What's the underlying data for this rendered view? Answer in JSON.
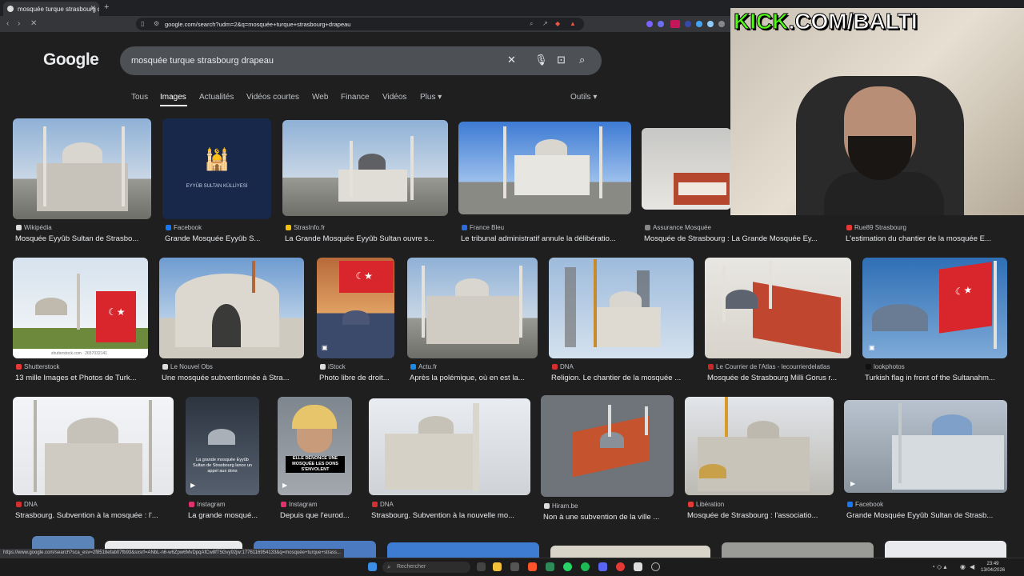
{
  "browser": {
    "tab_title": "mosquée turque strasbourg drap",
    "new_tab": "+",
    "url": "google.com/search?udm=2&q=mosquée+turque+strasbourg+drapeau",
    "status_url": "https://www.google.com/search?sca_esv=2f8518efab07fb93&sxsrf=ANbL-n6-w6Zpw6MvDpqAfCw8fT5Gvy92jw:1776116954133&q=mosquée+turque+strass..."
  },
  "google": {
    "logo": "Google",
    "query": "mosquée turque strasbourg drapeau",
    "filters": [
      "Tous",
      "Images",
      "Actualités",
      "Vidéos courtes",
      "Web",
      "Finance",
      "Vidéos",
      "Plus ▾"
    ],
    "tools": "Outils ▾"
  },
  "results": [
    {
      "source": "Wikipédia",
      "title": "Mosquée Eyyûb Sultan de Strasbo..."
    },
    {
      "source": "Facebook",
      "title": "Grande Mosquée Eyyûb S..."
    },
    {
      "source": "StrasInfo.fr",
      "title": "La Grande Mosquée Eyyûb Sultan ouvre s..."
    },
    {
      "source": "France Bleu",
      "title": "Le tribunal administratif annule la délibératio..."
    },
    {
      "source": "Assurance Mosquée",
      "title": "Mosquée de Strasbourg : La Grande Mosquée Ey..."
    },
    {
      "source": "Rue89 Strasbourg",
      "title": "L'estimation du chantier de la mosquée E..."
    },
    {
      "source": "Shutterstock",
      "title": "13 mille Images et Photos de Turk..."
    },
    {
      "source": "Le Nouvel Obs",
      "title": "Une mosquée subventionnée à Stra..."
    },
    {
      "source": "iStock",
      "title": "Photo libre de droit..."
    },
    {
      "source": "Actu.fr",
      "title": "Après la polémique, où en est la..."
    },
    {
      "source": "DNA",
      "title": "Religion. Le chantier de la mosquée ..."
    },
    {
      "source": "Le Courrier de l'Atlas - lecourrierdelatlas",
      "title": "Mosquée de Strasbourg Milli Gorus r..."
    },
    {
      "source": "lookphotos",
      "title": "Turkish flag in front of the Sultanahm..."
    },
    {
      "source": "DNA",
      "title": "Strasbourg. Subvention à la mosquée : l'..."
    },
    {
      "source": "Instagram",
      "title": "La grande mosqué..."
    },
    {
      "source": "Instagram",
      "title": "Depuis que l'eurod..."
    },
    {
      "source": "DNA",
      "title": "Strasbourg. Subvention à la nouvelle mo..."
    },
    {
      "source": "Hiram.be",
      "title": "Non à une subvention de la ville ..."
    },
    {
      "source": "Libération",
      "title": "Mosquée de Strasbourg : l'associatio..."
    },
    {
      "source": "Facebook",
      "title": "Grande Mosquée Eyyûb Sultan de Strasb..."
    }
  ],
  "thumb_text": {
    "eyyub": "EYYÛB SULTAN KÜLLİYESİ",
    "shutter": "shutterstock.com · 2657032141",
    "insta1": "La grande mosquée Eyyûb Sultan de Strasbourg lance un appel aux dons",
    "insta2": "ELLE DÉNONCE UNE MOSQUÉE LES DONS S'ENVOLENT"
  },
  "overlay": {
    "kick_prefix": "KICK",
    "kick_suffix": ".COM/BALTI"
  },
  "taskbar": {
    "search": "Rechercher",
    "time": "23:49",
    "date": "13/04/2026"
  },
  "colors": {
    "background": "#1f1f1f",
    "search_box": "#4d5156",
    "kick_green": "#53fc18"
  }
}
